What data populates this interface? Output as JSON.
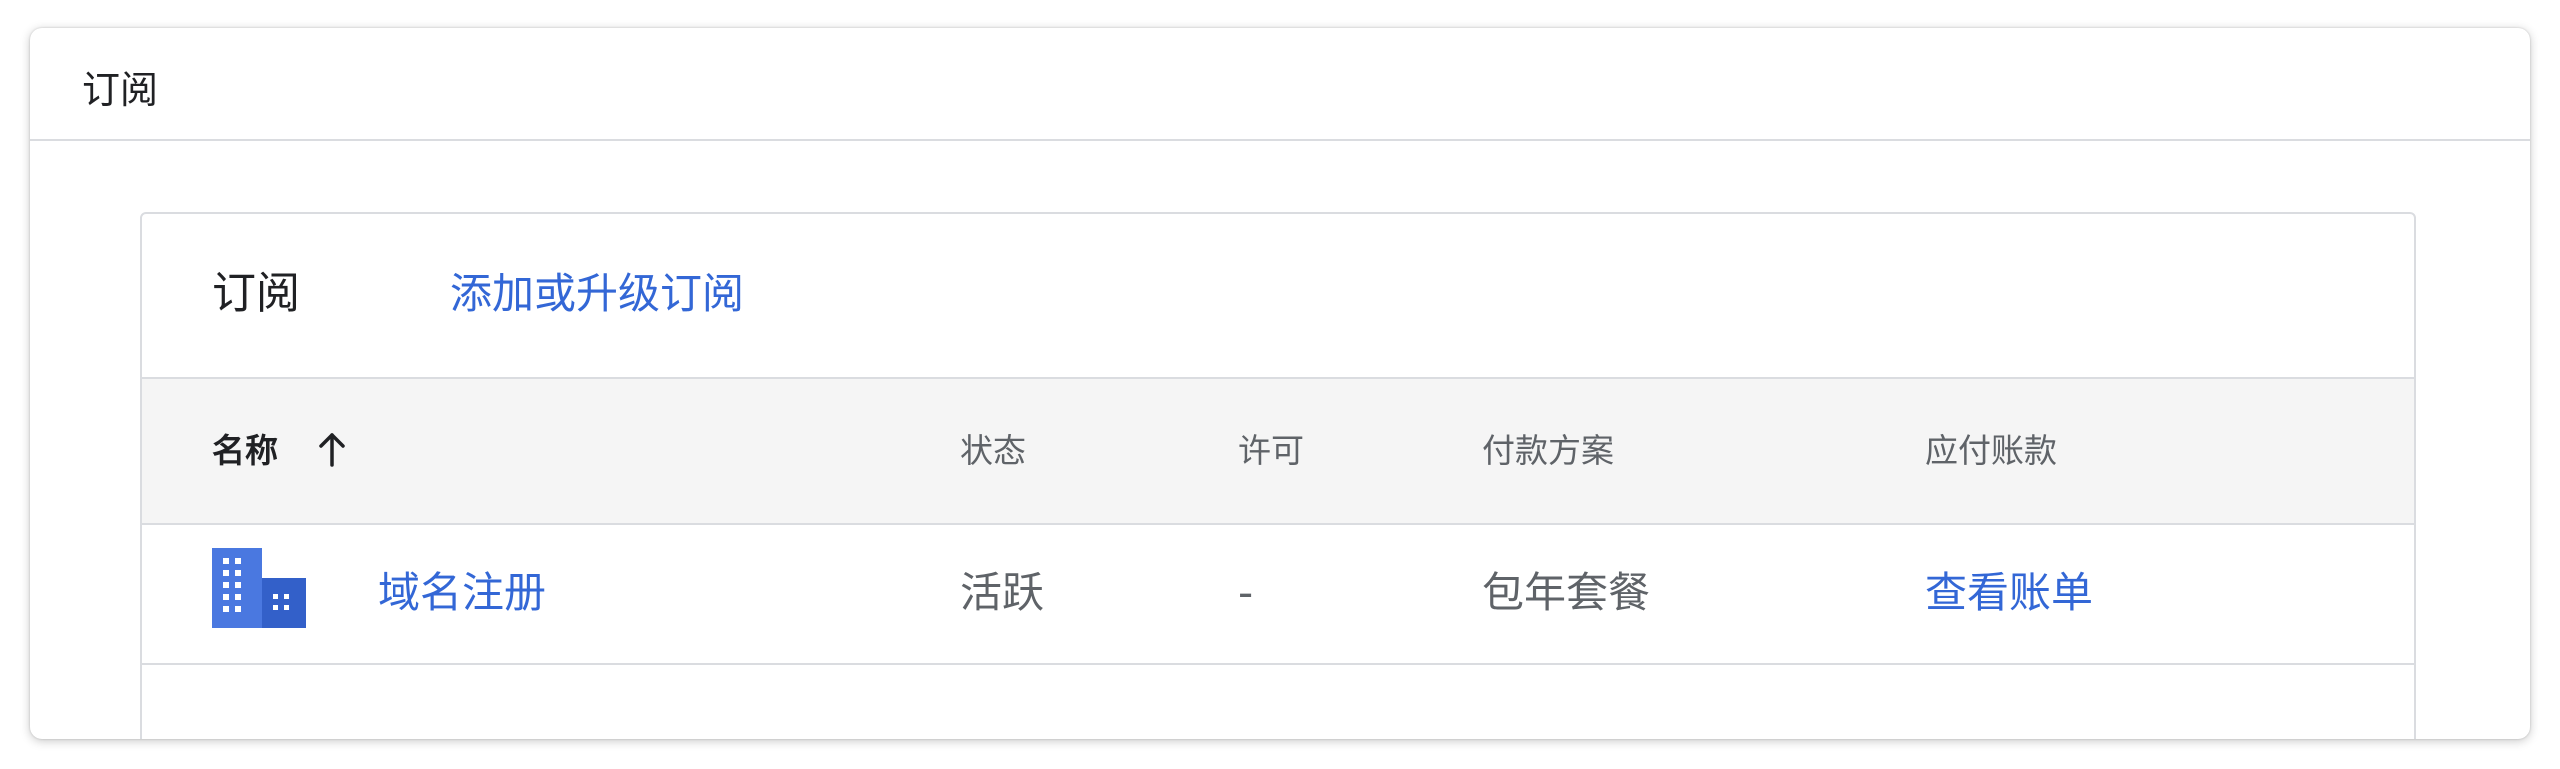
{
  "window": {
    "title": "订阅"
  },
  "card": {
    "title": "订阅",
    "action_label": "添加或升级订阅"
  },
  "table": {
    "headers": {
      "name": "名称",
      "status": "状态",
      "license": "许可",
      "plan": "付款方案",
      "payable": "应付账款"
    },
    "sort_icon": "arrow-up-icon",
    "rows": [
      {
        "icon": "building-icon",
        "name": "域名注册",
        "status": "活跃",
        "license": "-",
        "plan": "包年套餐",
        "payable": "查看账单"
      }
    ]
  },
  "colors": {
    "link": "#3367d6",
    "header_bg": "#f5f5f5",
    "border": "#dadce0",
    "icon_blue": "#4a78e0",
    "icon_dark": "#3360c9"
  }
}
